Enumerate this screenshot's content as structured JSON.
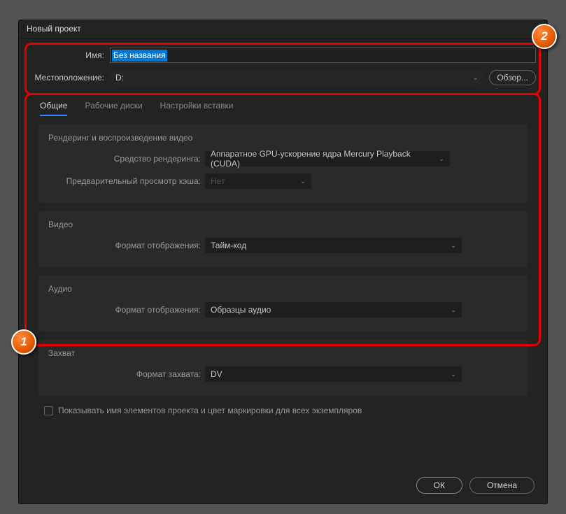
{
  "window": {
    "title": "Новый проект"
  },
  "form": {
    "name_label": "Имя:",
    "name_value": "Без названия",
    "location_label": "Местоположение:",
    "location_value": "D:",
    "browse_label": "Обзор..."
  },
  "tabs": {
    "general": "Общие",
    "scratch": "Рабочие диски",
    "ingest": "Настройки вставки"
  },
  "sections": {
    "rendering": {
      "title": "Рендеринг и воспроизведение видео",
      "renderer_label": "Средство рендеринга:",
      "renderer_value": "Аппаратное GPU-ускорение ядра Mercury Playback (CUDA)",
      "cache_label": "Предварительный просмотр кэша:",
      "cache_value": "Нет"
    },
    "video": {
      "title": "Видео",
      "format_label": "Формат отображения:",
      "format_value": "Тайм-код"
    },
    "audio": {
      "title": "Аудио",
      "format_label": "Формат отображения:",
      "format_value": "Образцы аудио"
    },
    "capture": {
      "title": "Захват",
      "format_label": "Формат захвата:",
      "format_value": "DV"
    }
  },
  "checkbox": {
    "label": "Показывать имя элементов проекта и цвет маркировки для всех экземпляров"
  },
  "footer": {
    "ok": "ОК",
    "cancel": "Отмена"
  },
  "callouts": {
    "one": "1",
    "two": "2"
  }
}
